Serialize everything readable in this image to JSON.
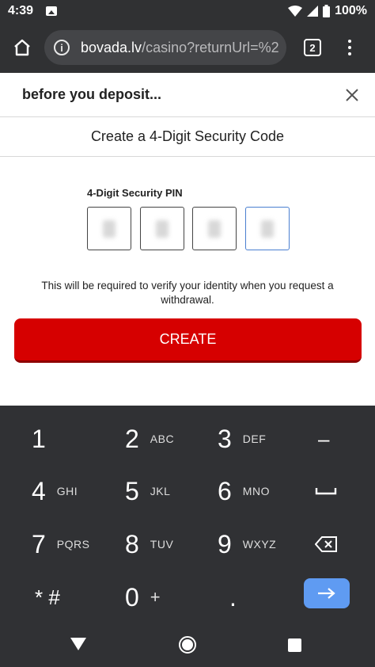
{
  "status_bar": {
    "time": "4:39",
    "battery": "100%"
  },
  "browser": {
    "url_host": "bovada.lv",
    "url_path": "/casino?returnUrl=%2",
    "tab_count": "2"
  },
  "modal": {
    "title": "before you deposit...",
    "section_title": "Create a 4-Digit Security Code",
    "pin_label": "4-Digit Security PIN",
    "help_text": "This will be required to verify your identity when you request a withdrawal.",
    "create_label": "CREATE"
  },
  "keyboard": {
    "rows": [
      [
        {
          "num": "1",
          "letters": ""
        },
        {
          "num": "2",
          "letters": "ABC"
        },
        {
          "num": "3",
          "letters": "DEF"
        },
        {
          "num": "–",
          "letters": ""
        }
      ],
      [
        {
          "num": "4",
          "letters": "GHI"
        },
        {
          "num": "5",
          "letters": "JKL"
        },
        {
          "num": "6",
          "letters": "MNO"
        },
        {
          "num": "␣",
          "letters": ""
        }
      ],
      [
        {
          "num": "7",
          "letters": "PQRS"
        },
        {
          "num": "8",
          "letters": "TUV"
        },
        {
          "num": "9",
          "letters": "WXYZ"
        },
        {
          "num": "⌫",
          "letters": ""
        }
      ],
      [
        {
          "num": "* #",
          "letters": ""
        },
        {
          "num": "0",
          "letters": "+"
        },
        {
          "num": ".",
          "letters": ""
        },
        {
          "num": "→",
          "letters": ""
        }
      ]
    ]
  },
  "colors": {
    "accent_red": "#d60000",
    "keyboard_bg": "#303134",
    "enter_blue": "#5f9bf2",
    "active_pin_border": "#4a7fd0"
  },
  "icons": {
    "home": "home-icon",
    "info": "info-icon",
    "menu": "more-vert-icon",
    "close": "close-icon",
    "backspace": "backspace-icon",
    "space": "space-icon",
    "enter": "arrow-right-icon"
  }
}
